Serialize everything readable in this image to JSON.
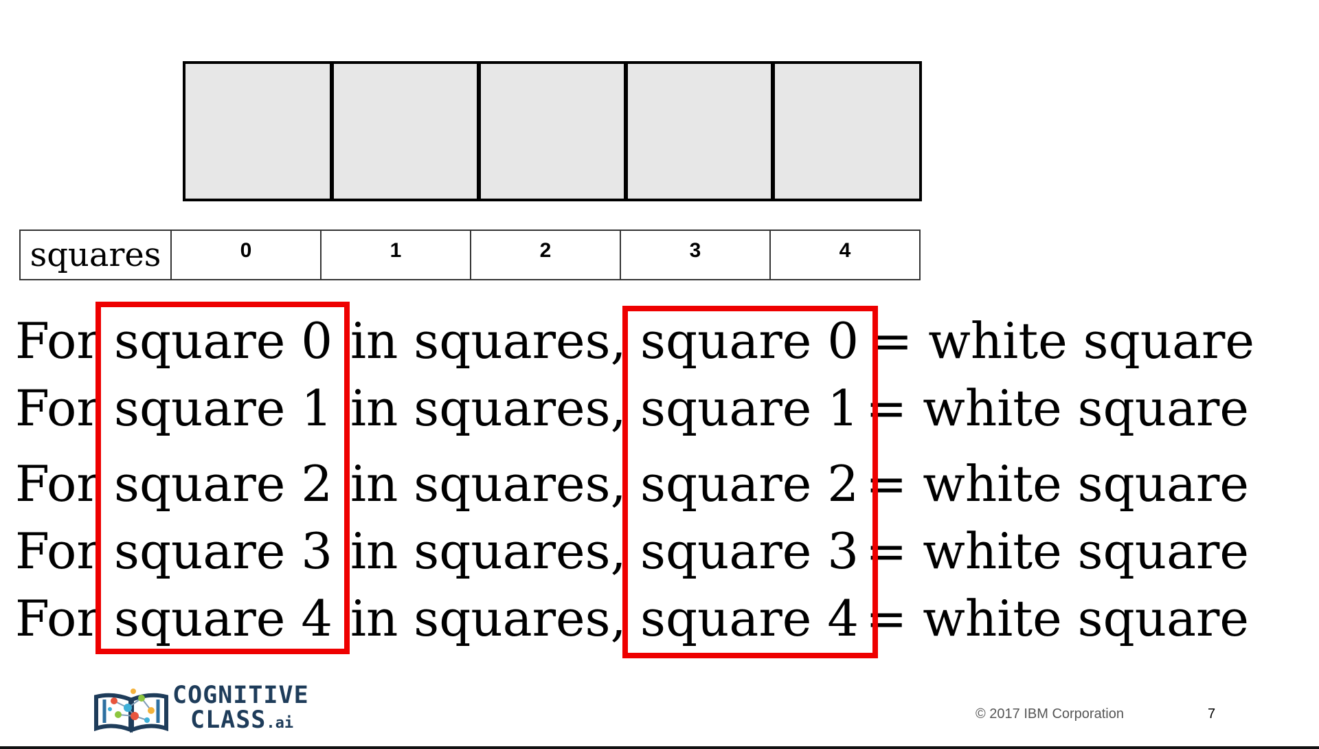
{
  "squares_row": {
    "label": "squares",
    "indices": [
      "0",
      "1",
      "2",
      "3",
      "4"
    ]
  },
  "box_fill": "#e7e7e7",
  "highlight_color": "#ee0000",
  "lines": [
    {
      "prefix": "For",
      "var1": "square 0",
      "middle": "in squares,",
      "var2": "square 0",
      "rest": "= white square"
    },
    {
      "prefix": "For",
      "var1": "square 1",
      "middle": "in squares,",
      "var2": "square 1",
      "rest": "= white square"
    },
    {
      "prefix": "For",
      "var1": "square 2",
      "middle": "in squares,",
      "var2": "square 2",
      "rest": "= white square"
    },
    {
      "prefix": "For",
      "var1": "square 3",
      "middle": "in squares,",
      "var2": "square 3",
      "rest": "= white square"
    },
    {
      "prefix": "For",
      "var1": "square 4",
      "middle": "in squares,",
      "var2": "square 4",
      "rest": "= white square"
    }
  ],
  "footer": {
    "logo_line1": "COGNITIVE",
    "logo_line2": "CLASS",
    "logo_suffix": ".ai",
    "logo_icon": "book-network-icon",
    "copyright": "© 2017 IBM Corporation",
    "page_number": "7"
  }
}
